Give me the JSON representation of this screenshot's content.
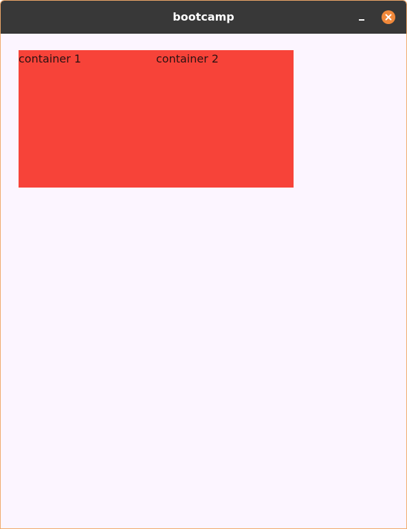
{
  "window": {
    "title": "bootcamp",
    "accent_color": "#f0883a",
    "titlebar_color": "#383838",
    "background_color": "#fcf5ff",
    "controls": {
      "minimize_icon": "minimize-icon",
      "close_icon": "close-icon"
    }
  },
  "main": {
    "container_color": "#f74339",
    "containers": [
      {
        "label": "container 1"
      },
      {
        "label": "container 2"
      }
    ]
  }
}
